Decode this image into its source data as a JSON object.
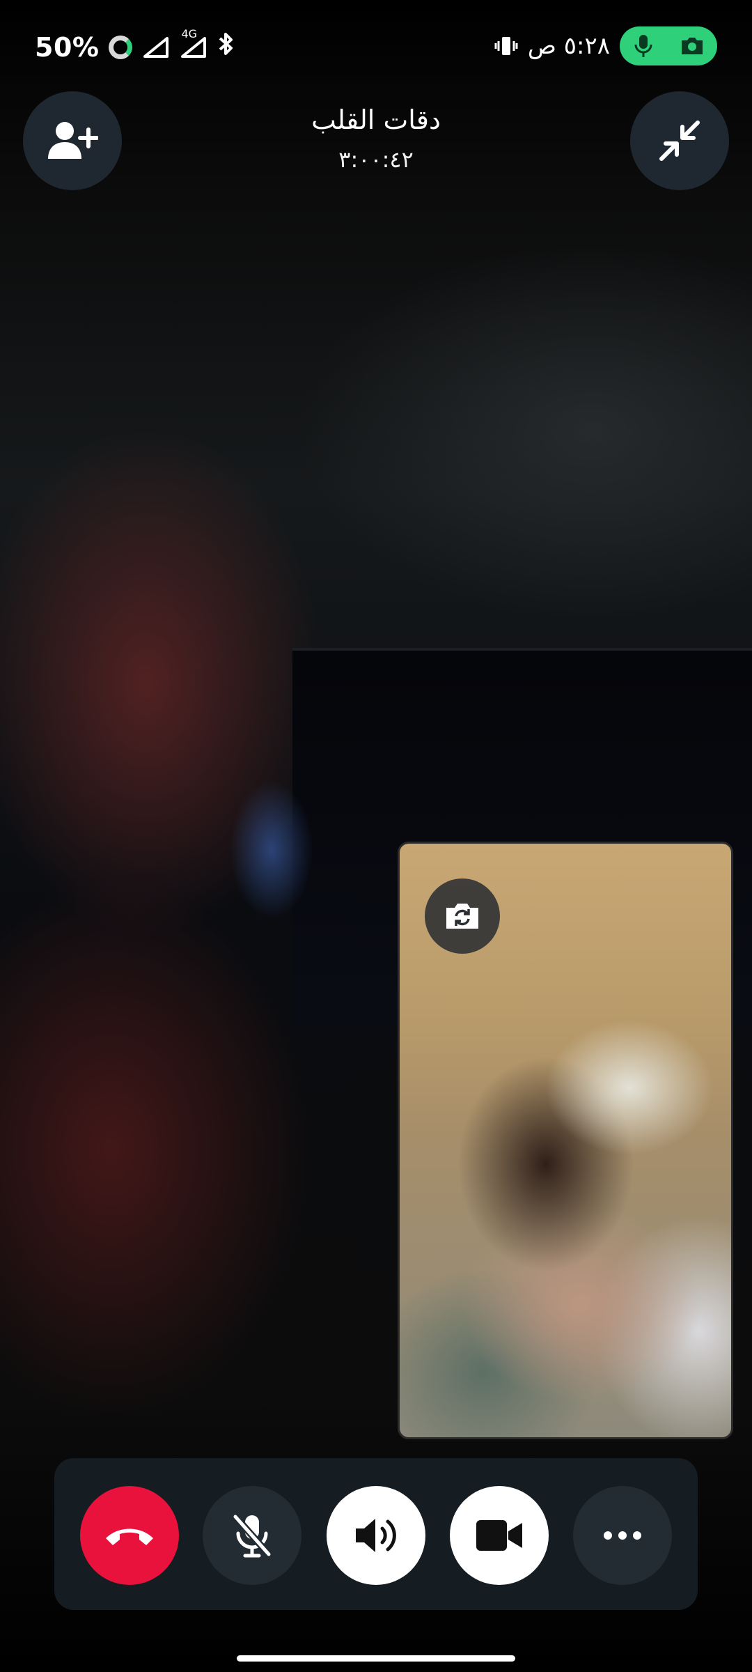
{
  "status_bar": {
    "battery": "50%",
    "network": "4G",
    "time": "٥:٢٨ ص"
  },
  "call": {
    "contact_name": "دقات القلب",
    "duration": "٣:٠٠:٤٢"
  },
  "colors": {
    "end_call": "#e8123c",
    "record_pill": "#2fd07a",
    "panel": "#151c22",
    "dark_button": "#232c33"
  },
  "icons": {
    "add_person": "add-person-icon",
    "minimize": "minimize-icon",
    "switch_camera": "switch-camera-icon",
    "end_call": "end-call-icon",
    "mute": "mic-off-icon",
    "speaker": "speaker-icon",
    "video": "video-camera-icon",
    "more": "more-icon"
  }
}
